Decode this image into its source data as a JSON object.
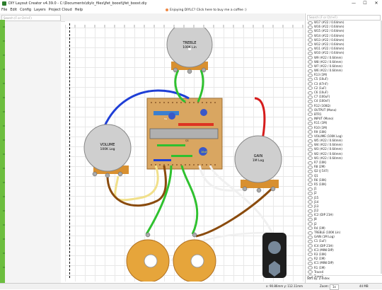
{
  "app": {
    "title": "DIY Layout Creator v4.39.0 - C:\\Documents\\diylc_files\\jfet_boost\\jfet_boost.diy",
    "minimize": "—",
    "maximize": "☐",
    "close": "✕"
  },
  "menu": [
    "File",
    "Edit",
    "Config",
    "Layers",
    "Project Cloud",
    "Help"
  ],
  "banner": {
    "text": "Enjoying DIYLC? Click here to buy me a coffee :)"
  },
  "palette": {
    "search_placeholder": "Search (F or Ctrl+F)"
  },
  "canvas": {
    "pots": [
      {
        "id": "treble",
        "label1": "TREBLE",
        "label2": "100K Lin"
      },
      {
        "id": "volume",
        "label1": "VOLUME",
        "label2": "100K Log"
      },
      {
        "id": "gain",
        "label1": "GAIN",
        "label2": "1M Log"
      }
    ],
    "board_labels": [
      "SG",
      "Q1",
      "10uF"
    ]
  },
  "right_panel": {
    "search_placeholder": "Search (F or Ctrl+F)",
    "items": [
      "W17 (#22 / 0.64mm)",
      "W16 (#22 / 0.64mm)",
      "W15 (#22 / 0.64mm)",
      "W14 (#22 / 0.64mm)",
      "W13 (#22 / 0.64mm)",
      "W12 (#22 / 0.64mm)",
      "W11 (#22 / 0.64mm)",
      "W10 (#22 / 0.64mm)",
      "W9 (#22 / 0.64mm)",
      "W8 (#22 / 0.64mm)",
      "W7 (#22 / 0.64mm)",
      "W6 (#22 / 0.64mm)",
      "R13 (1M)",
      "C5 (10uF)",
      "C3 (47nF)",
      "C2 (1uF)",
      "C6 (10uF)",
      "C7 (100uF)",
      "C4 (100nF)",
      "R12 (100Ω)",
      "OUTPUT (Mono)",
      "BTR1",
      "INPUT (Mono)",
      "R11 (1M)",
      "R10 (1M)",
      "R9 (10K)",
      "VOLUME (100K Log)",
      "W5 (#22 / 0.64mm)",
      "W4 (#22 / 0.64mm)",
      "W3 (#22 / 0.64mm)",
      "W2 (#22 / 0.64mm)",
      "W1 (#22 / 0.64mm)",
      "R7 (10K)",
      "R8 (2M)",
      "Q2 (J 547)",
      "Q1",
      "R6 (10K)",
      "R5 (10K)",
      "J1",
      "J2",
      "J15",
      "J14",
      "J13",
      "J12",
      "IC2 (DIP 21H)",
      "J8",
      "J2",
      "R4 (1M)",
      "TREBLE (100K Lin)",
      "GAIN (1M Log)",
      "C1 (1uF)",
      "IC4 (DIP 21H)",
      "IC3 (MINI DIP)",
      "R3 (10K)",
      "R2 (1M)",
      "IC1 (MINI DIP)",
      "R1 (1M)",
      "Trace4",
      "Trace2"
    ],
    "sort_label": "Sort by: Z-Index"
  },
  "status": {
    "left": "x: 90.86mm  y: 112.11mm",
    "zoom_label": "Zoom:",
    "zoom_value": "1x",
    "right": "44 MB"
  },
  "colors": {
    "board": "#d9a661",
    "blue_wire": "#1f3fd6",
    "green_wire": "#2fc12f",
    "red_wire": "#d61c1c",
    "yellow_wire": "#f1e08a",
    "brown_wire": "#8a4b0d",
    "pot_body": "#cfcfcf",
    "jack_orange": "#e6a53b"
  }
}
